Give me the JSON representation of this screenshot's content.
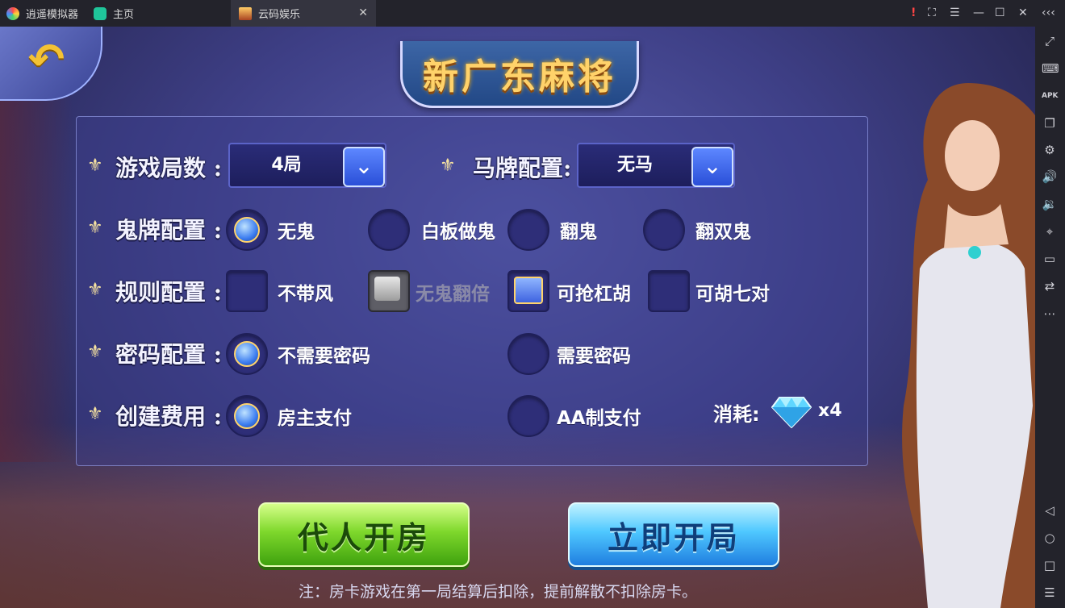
{
  "window": {
    "tabs": [
      {
        "label": "逍遥模拟器",
        "icon": "emulator-logo-icon"
      },
      {
        "label": "主页",
        "icon": "home-icon"
      },
      {
        "label": "云码娱乐",
        "icon": "app-thumbnail-icon"
      }
    ],
    "controls": [
      "alert-icon",
      "screenshot-icon",
      "menu-icon",
      "minimize-icon",
      "maximize-icon",
      "close-icon",
      "collapse-icon"
    ]
  },
  "sidebar": {
    "icons": [
      "fullscreen-icon",
      "keyboard-icon",
      "apk-icon",
      "multi-window-icon",
      "settings-icon",
      "volume-up-icon",
      "volume-down-icon",
      "location-icon",
      "folder-icon",
      "rotate-icon",
      "more-icon",
      "back-nav-icon",
      "home-nav-icon",
      "recent-apps-icon",
      "list-icon"
    ]
  },
  "game": {
    "title": "新广东麻将",
    "rows": {
      "rounds": {
        "label": "游戏局数 :",
        "value": "4局"
      },
      "horse": {
        "label": "马牌配置:",
        "value": "无马"
      },
      "ghost": {
        "label": "鬼牌配置 :",
        "options": [
          "无鬼",
          "白板做鬼",
          "翻鬼",
          "翻双鬼"
        ],
        "selected": 0
      },
      "rules": {
        "label": "规则配置 :",
        "options": [
          "不带风",
          "无鬼翻倍",
          "可抢杠胡",
          "可胡七对"
        ],
        "checked": [
          false,
          false,
          true,
          false
        ],
        "disabled": [
          false,
          true,
          false,
          false
        ]
      },
      "password": {
        "label": "密码配置 :",
        "options": [
          "不需要密码",
          "需要密码"
        ],
        "selected": 0
      },
      "fee": {
        "label": "创建费用 :",
        "options": [
          "房主支付",
          "AA制支付"
        ],
        "selected": 0
      }
    },
    "consume": {
      "label": "消耗:",
      "count": "x4"
    },
    "buttons": {
      "proxy": "代人开房",
      "start": "立即开局"
    },
    "note": "注：房卡游戏在第一局结算后扣除，提前解散不扣除房卡。"
  }
}
